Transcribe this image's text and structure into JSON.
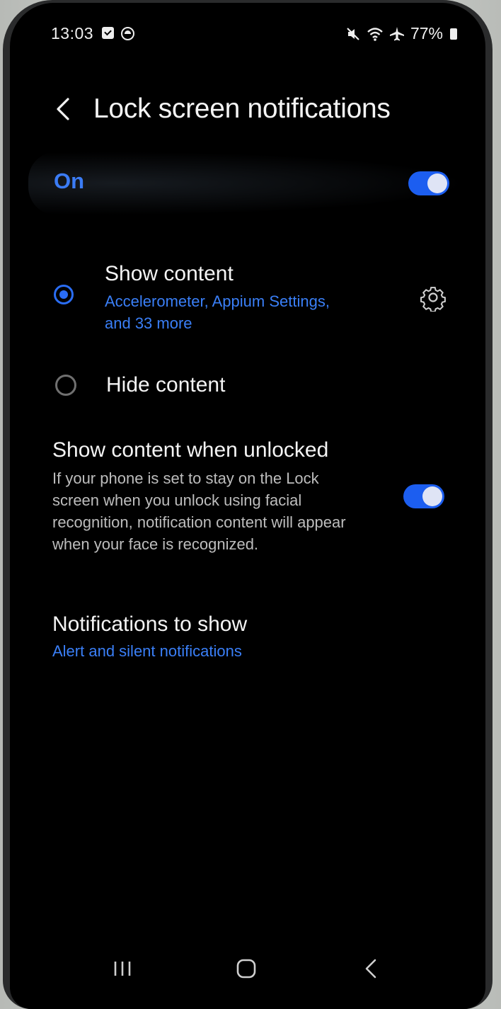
{
  "status_bar": {
    "time": "13:03",
    "battery": "77%",
    "icons": [
      "checkbox-icon",
      "face-icon",
      "mute-icon",
      "wifi-icon",
      "airplane-icon",
      "battery-icon"
    ]
  },
  "header": {
    "title": "Lock screen notifications"
  },
  "master_switch": {
    "label": "On",
    "state": true,
    "accent": "#1c5ef0"
  },
  "options": {
    "show_content": {
      "title": "Show content",
      "subtitle_line1": "Accelerometer, Appium Settings,",
      "subtitle_line2": "and 33 more",
      "selected": true
    },
    "hide_content": {
      "title": "Hide content",
      "selected": false
    }
  },
  "unlocked": {
    "title": "Show content when unlocked",
    "desc_line1": "If your phone is set to stay on the Lock",
    "desc_line2": "screen when you unlock using facial",
    "desc_line3": "recognition, notification content will appear",
    "desc_line4": "when your face is recognized.",
    "state": true
  },
  "notifications_to_show": {
    "title": "Notifications to show",
    "value": "Alert and silent notifications"
  },
  "nav_bar": {
    "buttons": [
      "recents-icon",
      "home-icon",
      "back-icon"
    ]
  }
}
